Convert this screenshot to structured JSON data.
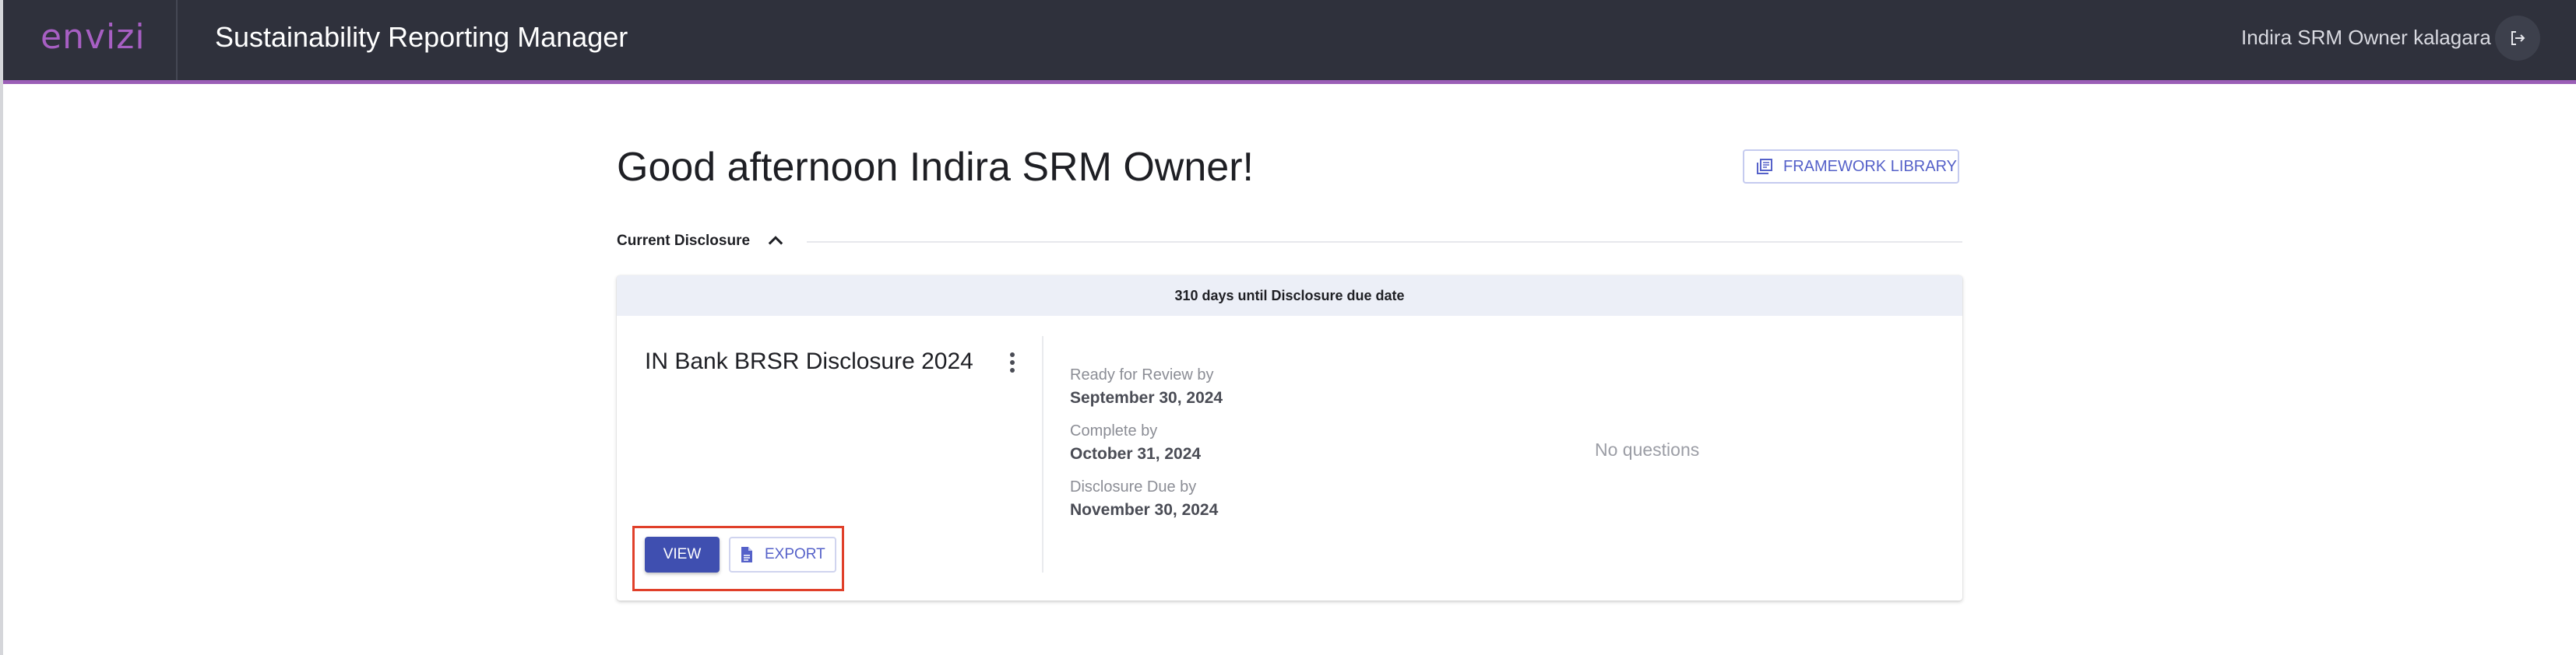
{
  "header": {
    "logo_text": "envizi",
    "app_title": "Sustainability Reporting Manager",
    "user_name": "Indira SRM Owner kalagara",
    "logout_icon": "logout-icon",
    "accent_color": "#9b5fb7",
    "background_color": "#2f313c"
  },
  "main": {
    "greeting": "Good afternoon Indira SRM Owner!",
    "framework_library_button": "FRAMEWORK LIBRARY",
    "section_label": "Current Disclosure",
    "section_toggle_icon": "chevron-up-icon"
  },
  "disclosure": {
    "due_banner": "310 days until Disclosure due date",
    "title": "IN Bank BRSR Disclosure 2024",
    "menu_icon": "more-vert-icon",
    "dates": [
      {
        "label": "Ready for Review by",
        "value": "September 30, 2024"
      },
      {
        "label": "Complete by",
        "value": "October 31, 2024"
      },
      {
        "label": "Disclosure Due by",
        "value": "November 30, 2024"
      }
    ],
    "questions_status": "No questions",
    "view_button": "VIEW",
    "export_button": "EXPORT",
    "primary_color": "#3f4fb0",
    "highlight_color": "#e0402a"
  }
}
